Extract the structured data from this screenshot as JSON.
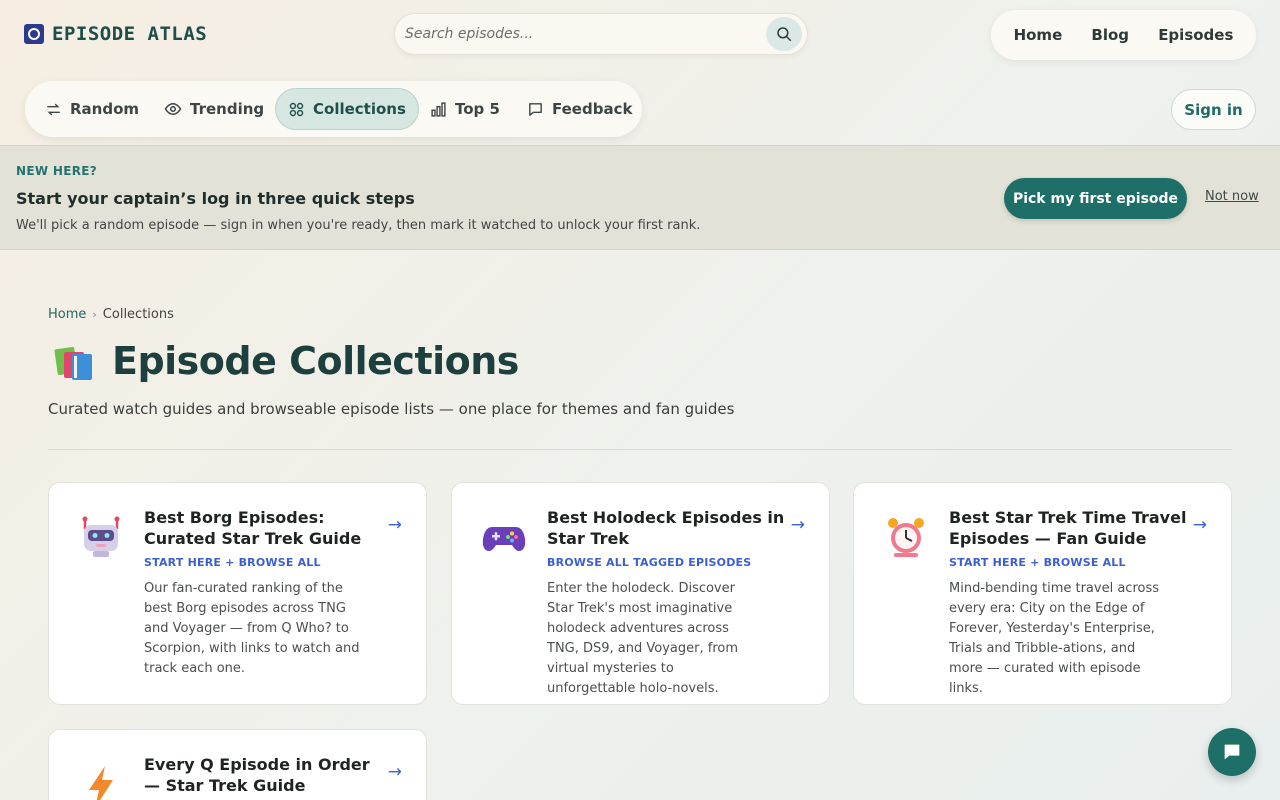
{
  "brand": {
    "name": "EPISODE ATLAS"
  },
  "search": {
    "placeholder": "Search episodes..."
  },
  "topnav": {
    "items": [
      {
        "label": "Home"
      },
      {
        "label": "Blog"
      },
      {
        "label": "Episodes"
      }
    ]
  },
  "subnav": {
    "items": [
      {
        "label": "Random",
        "icon": "shuffle-icon"
      },
      {
        "label": "Trending",
        "icon": "eye-icon"
      },
      {
        "label": "Collections",
        "icon": "grid-icon",
        "active": true
      },
      {
        "label": "Top 5",
        "icon": "bar-chart-icon"
      },
      {
        "label": "Feedback",
        "icon": "message-icon"
      }
    ]
  },
  "auth": {
    "signin_label": "Sign in"
  },
  "banner": {
    "kicker": "NEW HERE?",
    "title": "Start your captain’s log in three quick steps",
    "text": "We'll pick a random episode — sign in when you're ready, then mark it watched to unlock your first rank.",
    "cta_label": "Pick my first episode",
    "dismiss_label": "Not now"
  },
  "breadcrumb": {
    "home": "Home",
    "current": "Collections",
    "separator": "›"
  },
  "page": {
    "title": "Episode Collections",
    "subtitle": "Curated watch guides and browseable episode lists — one place for themes and fan guides"
  },
  "cards": [
    {
      "icon": "robot-icon",
      "title": "Best Borg Episodes: Curated Star Trek Guide",
      "tag": "START HERE + BROWSE ALL",
      "description": "Our fan-curated ranking of the best Borg episodes across TNG and Voyager — from Q Who? to Scorpion, with links to watch and track each one.",
      "arrow": "→"
    },
    {
      "icon": "game-controller-icon",
      "title": "Best Holodeck Episodes in Star Trek",
      "tag": "BROWSE ALL TAGGED EPISODES",
      "description": "Enter the holodeck. Discover Star Trek's most imaginative holodeck adventures across TNG, DS9, and Voyager, from virtual mysteries to unforgettable holo-novels.",
      "arrow": "→"
    },
    {
      "icon": "alarm-clock-icon",
      "title": "Best Star Trek Time Travel Episodes — Fan Guide",
      "tag": "START HERE + BROWSE ALL",
      "description": "Mind-bending time travel across every era: City on the Edge of Forever, Yesterday's Enterprise, Trials and Tribble-ations, and more — curated with episode links.",
      "arrow": "→"
    },
    {
      "icon": "lightning-icon",
      "title": "Every Q Episode in Order — Star Trek Guide",
      "tag": "",
      "description": "",
      "arrow": "→"
    }
  ]
}
